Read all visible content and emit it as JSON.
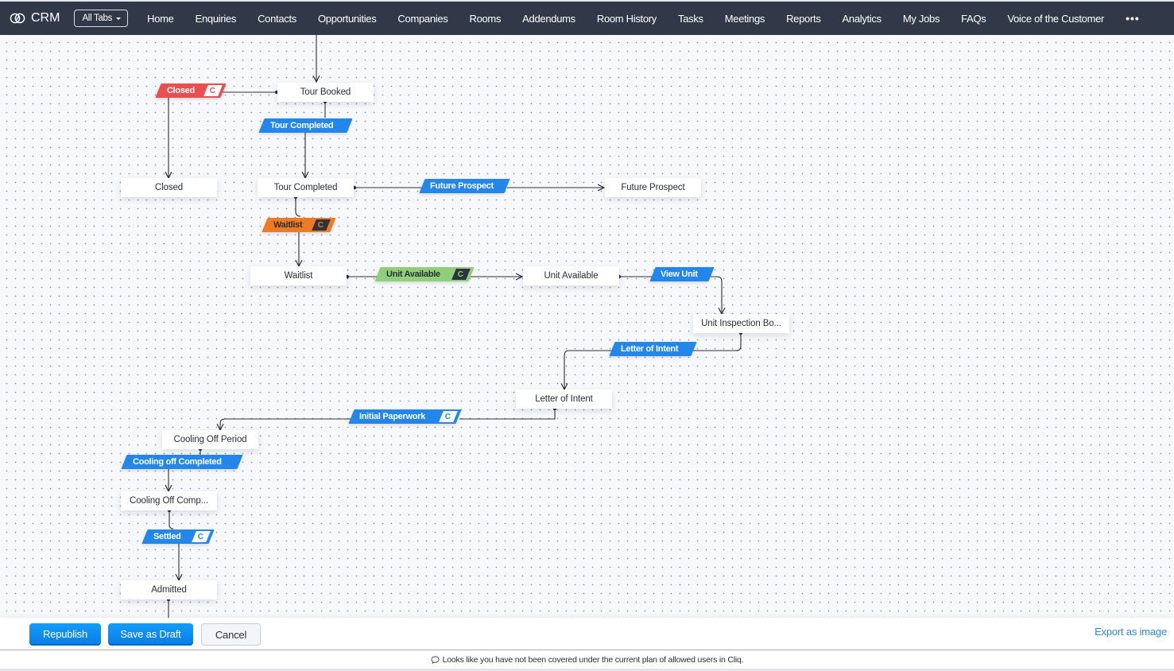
{
  "app": {
    "title": "CRM",
    "logo_icon": "zoho-rings-icon"
  },
  "topbar": {
    "all_tabs_label": "All Tabs",
    "nav": [
      "Home",
      "Enquiries",
      "Contacts",
      "Opportunities",
      "Companies",
      "Rooms",
      "Addendums",
      "Room History",
      "Tasks",
      "Meetings",
      "Reports",
      "Analytics",
      "My Jobs",
      "FAQs",
      "Voice of the Customer"
    ],
    "more_label": "•••"
  },
  "blueprint": {
    "states": {
      "tour_booked": "Tour Booked",
      "closed": "Closed",
      "tour_completed": "Tour Completed",
      "future_prospect": "Future Prospect",
      "waitlist": "Waitlist",
      "unit_available": "Unit Available",
      "unit_inspection": "Unit Inspection Bo...",
      "letter_of_intent": "Letter of Intent",
      "cooling_off_period": "Cooling Off Period",
      "cooling_off_comp": "Cooling Off Comp...",
      "admitted": "Admitted"
    },
    "transitions": {
      "closed": {
        "label": "Closed",
        "badge": "C",
        "color": "#ea4f4f"
      },
      "tour_completed": {
        "label": "Tour Completed",
        "color": "#2286eb"
      },
      "future_prospect": {
        "label": "Future Prospect",
        "color": "#2286eb"
      },
      "waitlist": {
        "label": "Waitlist",
        "badge": "C",
        "color": "#ee7b22"
      },
      "unit_available": {
        "label": "Unit Available",
        "badge": "C",
        "color": "#8fcf78"
      },
      "view_unit": {
        "label": "View Unit",
        "color": "#2286eb"
      },
      "letter_of_intent": {
        "label": "Letter of Intent",
        "color": "#2286eb"
      },
      "initial_paperwork": {
        "label": "Initial Paperwork",
        "badge": "C",
        "color": "#2286eb"
      },
      "cooling_off_completed": {
        "label": "Cooling off Completed",
        "color": "#2286eb"
      },
      "settled": {
        "label": "Settled",
        "badge": "C",
        "color": "#2286eb"
      }
    }
  },
  "footer": {
    "republish": "Republish",
    "save_draft": "Save as Draft",
    "cancel": "Cancel",
    "export": "Export as image"
  },
  "notice": {
    "icon": "cliq-chat-icon",
    "text": "Looks like you have not been covered under the current plan of allowed users in Cliq."
  }
}
